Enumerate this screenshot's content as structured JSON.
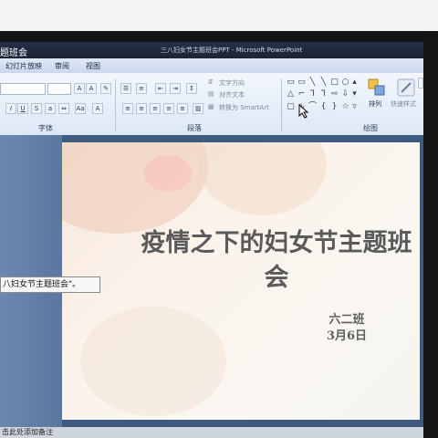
{
  "window": {
    "title": "三八妇女节主题班会PPT - Microsoft PowerPoint",
    "left_title_fragment": "题班会"
  },
  "ribbon": {
    "tabs": [
      {
        "label": "幻灯片放映"
      },
      {
        "label": "审阅"
      },
      {
        "label": "视图"
      }
    ],
    "groups": {
      "font": "字体",
      "paragraph": "段落",
      "drawing": "绘图"
    },
    "paragraph_buttons": {
      "text_direction": "文字方向",
      "align_text": "对齐文本",
      "convert_smartart": "转换为 SmartArt"
    },
    "drawing_buttons": {
      "arrange": "排列",
      "quick_styles": "快速样式"
    }
  },
  "tooltip": {
    "text": "八妇女节主题班会\"。"
  },
  "slide": {
    "title": "疫情之下的妇女节主题班会",
    "class_name": "六二班",
    "date": "3月6日"
  },
  "status": {
    "notes_placeholder": "击此处添加备注"
  },
  "colors": {
    "ribbon_bg": "#dde7f5",
    "titlebar_bg": "#1c2436",
    "workspace_bg": "#3f5a7f",
    "slide_text": "#5a5a5a"
  }
}
